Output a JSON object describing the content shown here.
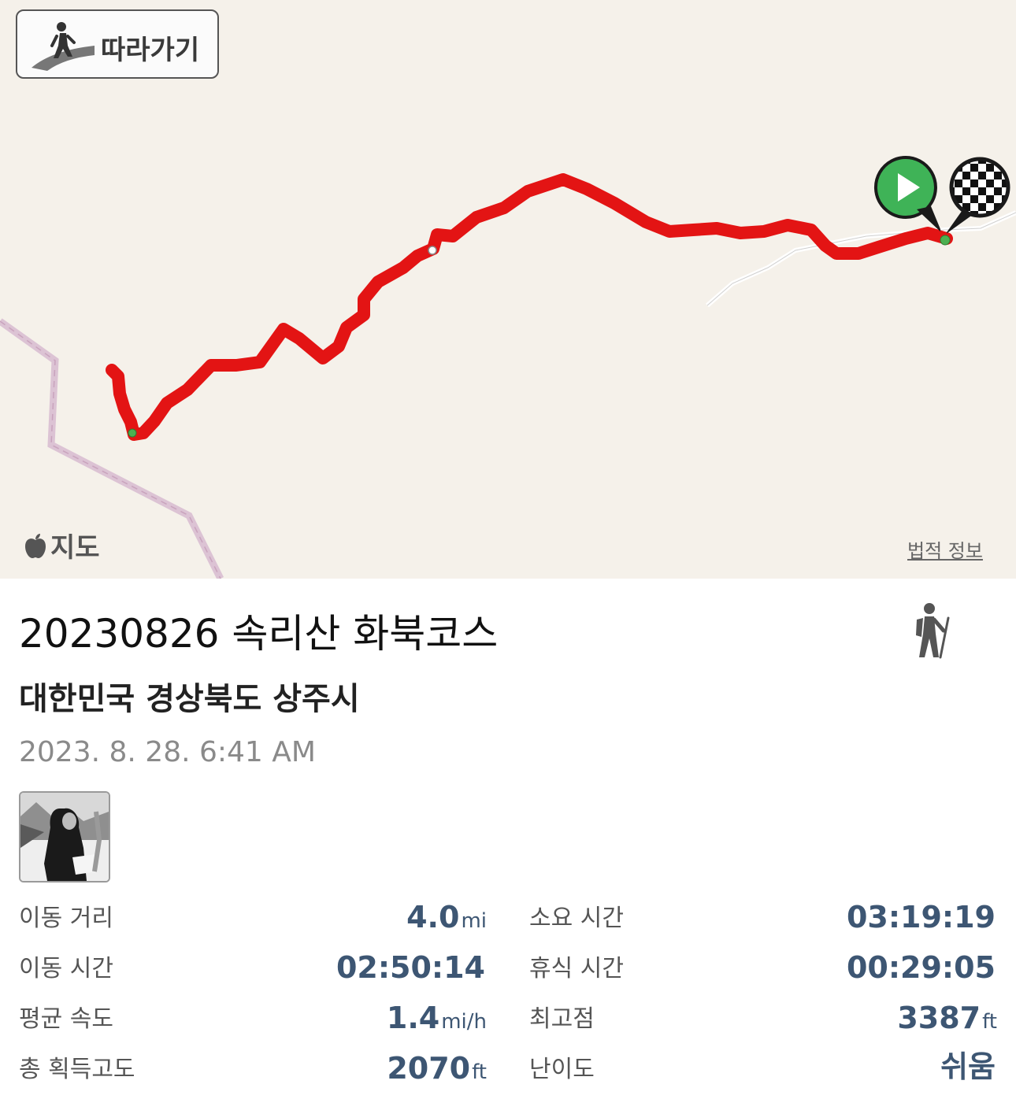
{
  "map": {
    "follow_button": {
      "label": "따라가기",
      "icon": "hiker-on-path-icon"
    },
    "attribution": {
      "icon": "apple-logo-icon",
      "text": "지도"
    },
    "legal_link": "법적 정보",
    "route_color": "#e01515",
    "markers": {
      "start": {
        "icon": "play-icon",
        "color": "#3fb357"
      },
      "finish": {
        "icon": "checkered-flag-icon"
      }
    }
  },
  "track": {
    "title": "20230826 속리산 화북코스",
    "activity_icon": "hiking-icon",
    "location": "대한민국 경상북도 상주시",
    "datetime": "2023. 8. 28. 6:41 AM"
  },
  "stats": {
    "distance": {
      "label": "이동 거리",
      "value": "4.0",
      "unit": "mi"
    },
    "total_time": {
      "label": "소요 시간",
      "value": "03:19:19",
      "unit": ""
    },
    "moving_time": {
      "label": "이동 시간",
      "value": "02:50:14",
      "unit": ""
    },
    "rest_time": {
      "label": "휴식 시간",
      "value": "00:29:05",
      "unit": ""
    },
    "avg_speed": {
      "label": "평균 속도",
      "value": "1.4",
      "unit": "mi/h"
    },
    "max_elevation": {
      "label": "최고점",
      "value": "3387",
      "unit": "ft"
    },
    "elevation_gain": {
      "label": "총 획득고도",
      "value": "2070",
      "unit": "ft"
    },
    "difficulty": {
      "label": "난이도",
      "value": "쉬움",
      "unit": ""
    }
  },
  "colors": {
    "stat_value": "#3d5673",
    "map_bg": "#f5f1ea"
  }
}
